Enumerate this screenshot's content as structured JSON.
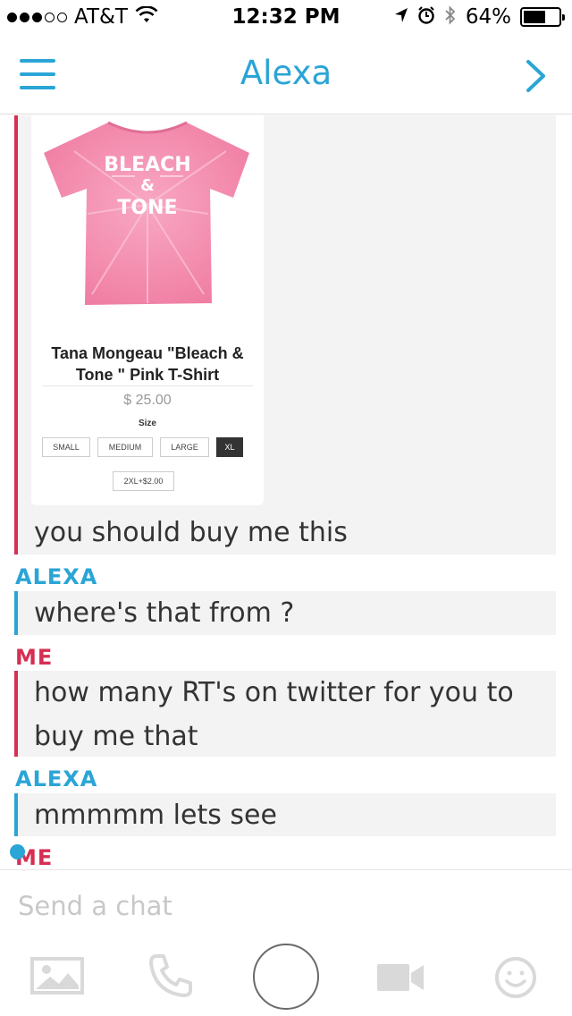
{
  "status_bar": {
    "carrier": "AT&T",
    "time": "12:32 PM",
    "battery": "64%",
    "battery_level": 0.64,
    "signal_bars": 3,
    "icons": [
      "wifi-icon",
      "location-icon",
      "alarm-icon",
      "bluetooth-icon",
      "battery-icon"
    ]
  },
  "header": {
    "title": "Alexa",
    "menu_icon": "hamburger-menu-icon",
    "forward_icon": "chevron-right-icon"
  },
  "product": {
    "name": "Tana Mongeau \"Bleach & Tone \" Pink T-Shirt",
    "price": "$ 25.00",
    "size_label": "Size",
    "sizes": [
      "SMALL",
      "MEDIUM",
      "LARGE",
      "XL",
      "2XL+$2.00"
    ],
    "selected_size": "XL",
    "shirt_text": [
      "BLEACH",
      "&",
      "TONE"
    ]
  },
  "messages": [
    {
      "sender": "",
      "text": "you should buy me this"
    },
    {
      "sender": "ALEXA",
      "text": "where's that from ?"
    },
    {
      "sender": "ME",
      "text_line1": "how many RT's on twitter for you to",
      "text_line2": "buy me that"
    },
    {
      "sender": "ALEXA",
      "text": "mmmmm lets see"
    },
    {
      "sender": "ME"
    }
  ],
  "compose": {
    "placeholder": "Send a chat",
    "icons": [
      "gallery-icon",
      "phone-icon",
      "capture-button",
      "video-icon",
      "emoji-icon"
    ]
  },
  "colors": {
    "accent_blue": "#2aa5d6",
    "me_red": "#d62f52",
    "bubble_bg": "#f3f3f3",
    "shirt_pink": "#f48fb0"
  }
}
